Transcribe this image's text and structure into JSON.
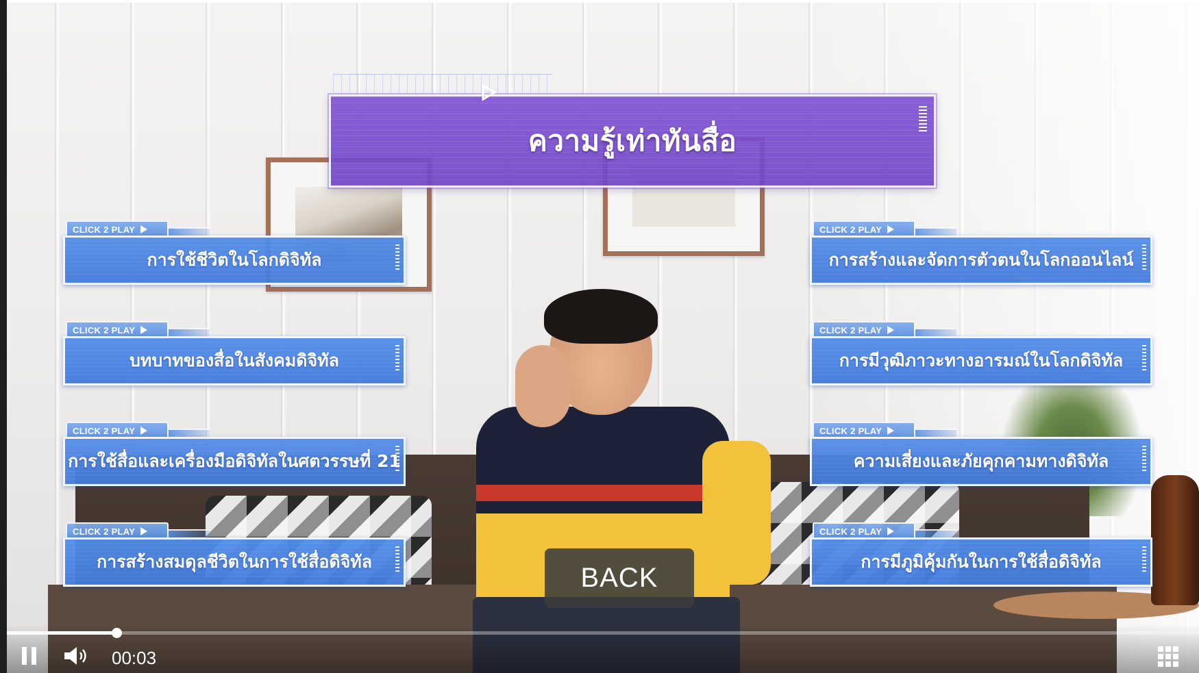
{
  "title": "ความรู้เท่าทันสื่อ",
  "topics": [
    {
      "tag": "CLICK 2 PLAY",
      "label": "การใช้ชีวิตในโลกดิจิทัล"
    },
    {
      "tag": "CLICK 2 PLAY",
      "label": "บทบาทของสื่อในสังคมดิจิทัล"
    },
    {
      "tag": "CLICK 2 PLAY",
      "label": "การใช้สื่อและเครื่องมือดิจิทัลในศตวรรษที่ 21"
    },
    {
      "tag": "CLICK 2 PLAY",
      "label": "การสร้างสมดุลชีวิตในการใช้สื่อดิจิทัล"
    },
    {
      "tag": "CLICK 2 PLAY",
      "label": "การสร้างและจัดการตัวตนในโลกออนไลน์"
    },
    {
      "tag": "CLICK 2 PLAY",
      "label": "การมีวุฒิภาวะทางอารมณ์ในโลกดิจิทัล"
    },
    {
      "tag": "CLICK 2 PLAY",
      "label": "ความเสี่ยงและภัยคุกคามทางดิจิทัล"
    },
    {
      "tag": "CLICK 2 PLAY",
      "label": "การมีภูมิคุ้มกันในการใช้สื่อดิจิทัล"
    }
  ],
  "back_label": "BACK",
  "player": {
    "time": "00:03",
    "progress_fraction": 0.092,
    "icons": {
      "play_pause": "pause-icon",
      "volume": "volume-icon",
      "menu": "grid-menu-icon",
      "topic_play": "play-icon"
    }
  },
  "colors": {
    "title_purple": "#7a4fd0",
    "topic_blue": "#4f86de"
  }
}
